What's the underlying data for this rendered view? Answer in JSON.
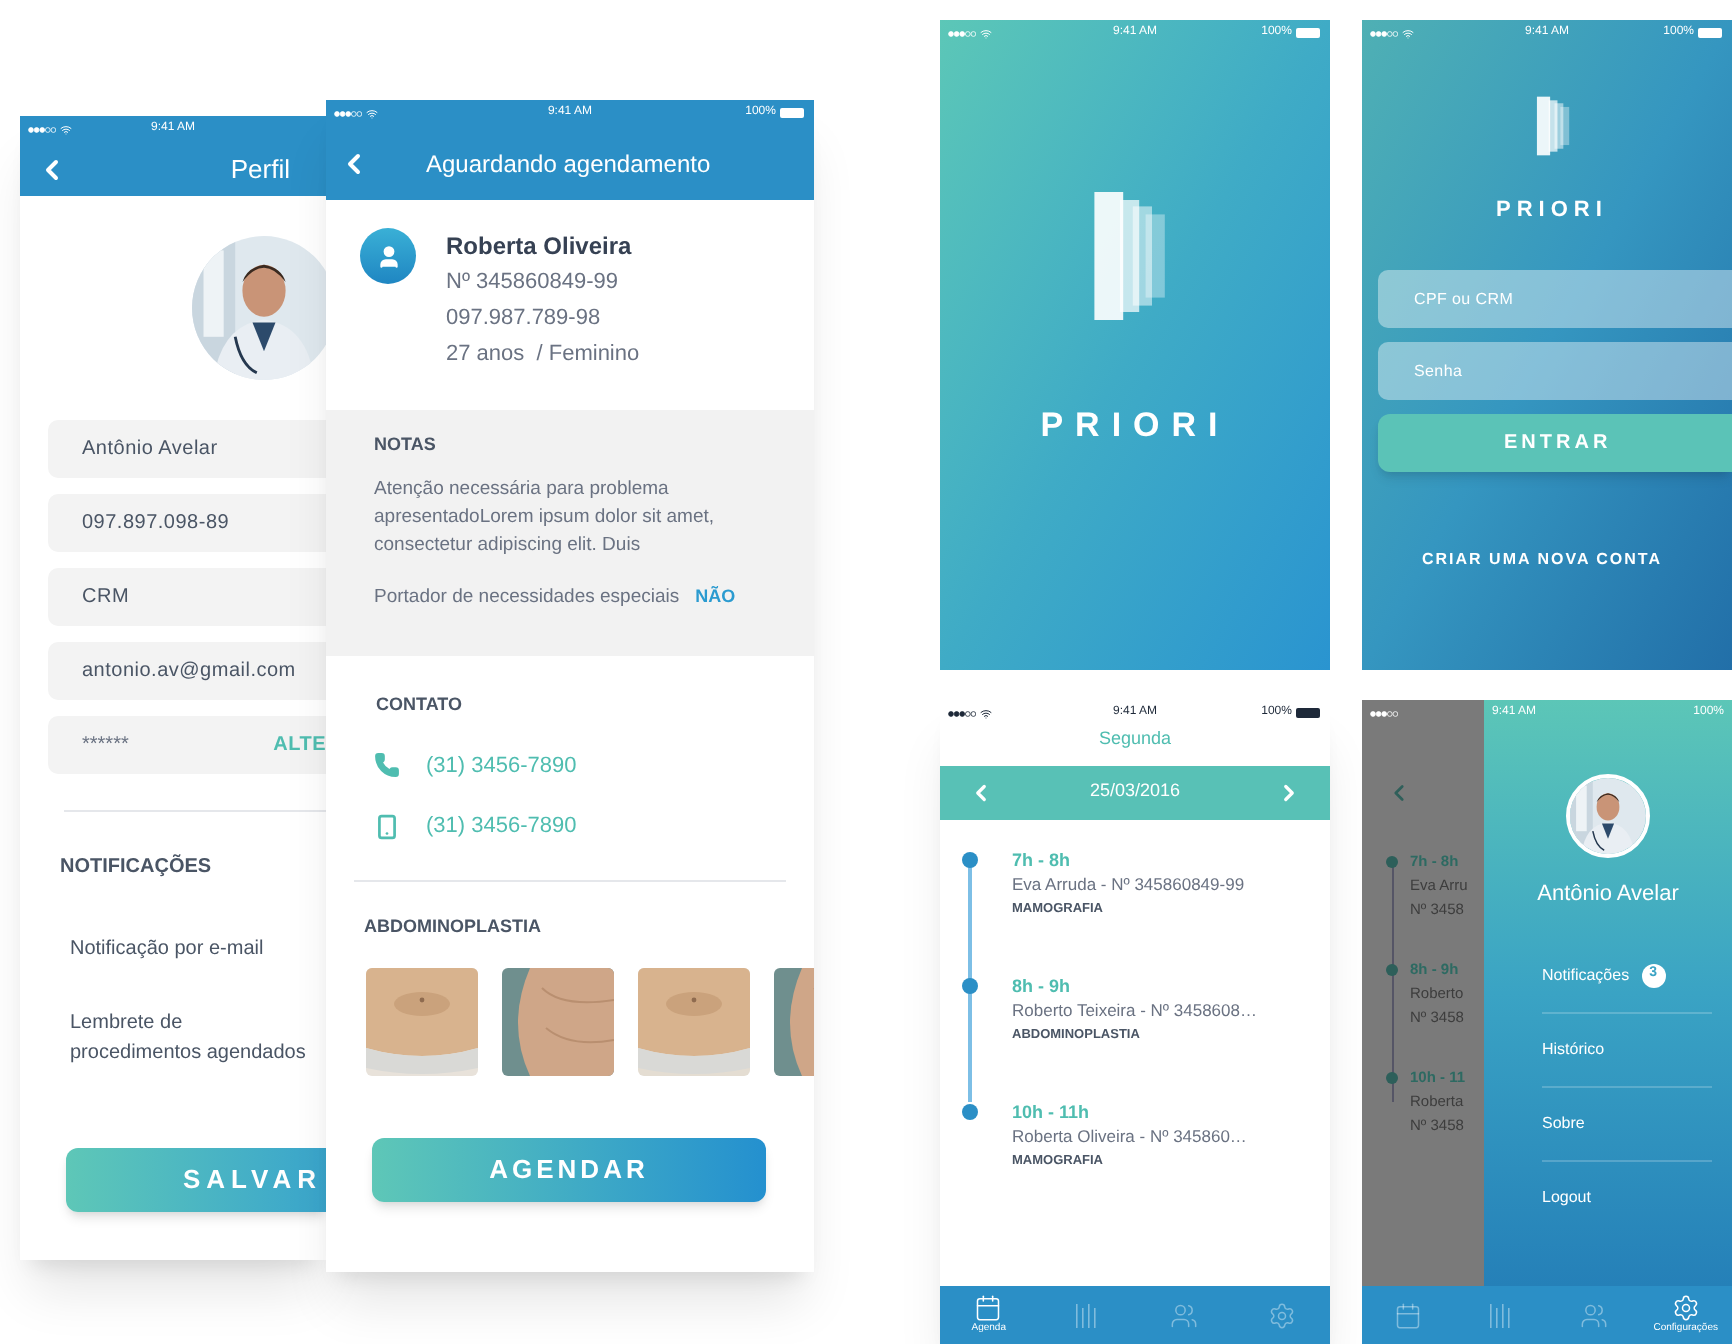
{
  "profile_screen": {
    "status_bar": {
      "time": "9:41 AM"
    },
    "title": "Perfil",
    "fields": [
      "Antônio Avelar",
      "097.897.098-89",
      "CRM",
      "antonio.av@gmail.com"
    ],
    "password": {
      "value": "******",
      "action": "ALTE"
    },
    "notifications": {
      "heading": "NOTIFICAÇÕES",
      "options": [
        "Notificação por e-mail",
        "Lembrete de procedimentos agendados"
      ]
    },
    "save_button": "SALVAR"
  },
  "appointment_screen": {
    "status_bar": {
      "time": "9:41 AM",
      "battery": "100%"
    },
    "title": "Aguardando agendamento",
    "patient": {
      "name": "Roberta Oliveira",
      "number": "Nº 345860849-99",
      "document": "097.987.789-98",
      "age_sex": "27 anos  / Feminino"
    },
    "notes": {
      "heading": "NOTAS",
      "text": "Atenção necessária para problema apresentadoLorem ipsum dolor sit amet, consectetur adipiscing elit. Duis",
      "special_needs_label": "Portador de necessidades especiais",
      "special_needs_value": "NÃO"
    },
    "contact": {
      "heading": "CONTATO",
      "phones": [
        {
          "kind": "phone",
          "number": "(31) 3456-7890"
        },
        {
          "kind": "mobile",
          "number": "(31) 3456-7890"
        }
      ]
    },
    "procedure": {
      "heading": "ABDOMINOPLASTIA"
    },
    "schedule_button": "AGENDAR"
  },
  "splash_screen": {
    "status_bar": {
      "time": "9:41 AM",
      "battery": "100%"
    },
    "brand": "PRIORI"
  },
  "login_screen": {
    "status_bar": {
      "time": "9:41 AM",
      "battery": "100%"
    },
    "brand": "PRIORI",
    "fields": [
      {
        "placeholder": "CPF ou CRM"
      },
      {
        "placeholder": "Senha"
      }
    ],
    "login_button": "ENTRAR",
    "signup_link": "CRIAR UMA NOVA CONTA"
  },
  "agenda_screen": {
    "status_bar": {
      "time": "9:41 AM",
      "battery": "100%"
    },
    "day": "Segunda",
    "date": "25/03/2016",
    "appointments": [
      {
        "time": "7h - 8h",
        "patient": "Eva Arruda -  Nº 345860849-99",
        "procedure": "MAMOGRAFIA"
      },
      {
        "time": "8h - 9h",
        "patient": "Roberto Teixeira - Nº 3458608…",
        "procedure": "ABDOMINOPLASTIA"
      },
      {
        "time": "10h - 11h",
        "patient": "Roberta Oliveira -  Nº 345860…",
        "procedure": "MAMOGRAFIA"
      }
    ],
    "tabs": [
      {
        "kind": "calendar",
        "label": "Agenda",
        "selected": true
      },
      {
        "kind": "bars",
        "selected": false
      },
      {
        "kind": "people",
        "selected": false
      },
      {
        "kind": "settings",
        "selected": false
      }
    ]
  },
  "menu_screen": {
    "status_bar": {
      "time": "9:41 AM",
      "battery": "100%"
    },
    "background_agenda": [
      {
        "time": "7h - 8h",
        "patient": "Eva Arru",
        "number": "Nº 3458"
      },
      {
        "time": "8h - 9h",
        "patient": "Roberto",
        "number": "Nº 3458"
      },
      {
        "time": "10h - 11",
        "patient": "Roberta",
        "number": "Nº 3458"
      }
    ],
    "user_name": "Antônio Avelar",
    "items": [
      {
        "label": "Notificações",
        "badge": "3"
      },
      {
        "label": "Histórico"
      },
      {
        "label": "Sobre"
      },
      {
        "label": "Logout"
      }
    ],
    "tabs": [
      {
        "kind": "calendar",
        "selected": false
      },
      {
        "kind": "bars",
        "selected": false
      },
      {
        "kind": "people",
        "selected": false
      },
      {
        "kind": "settings",
        "label": "Configurações",
        "selected": true
      }
    ]
  }
}
